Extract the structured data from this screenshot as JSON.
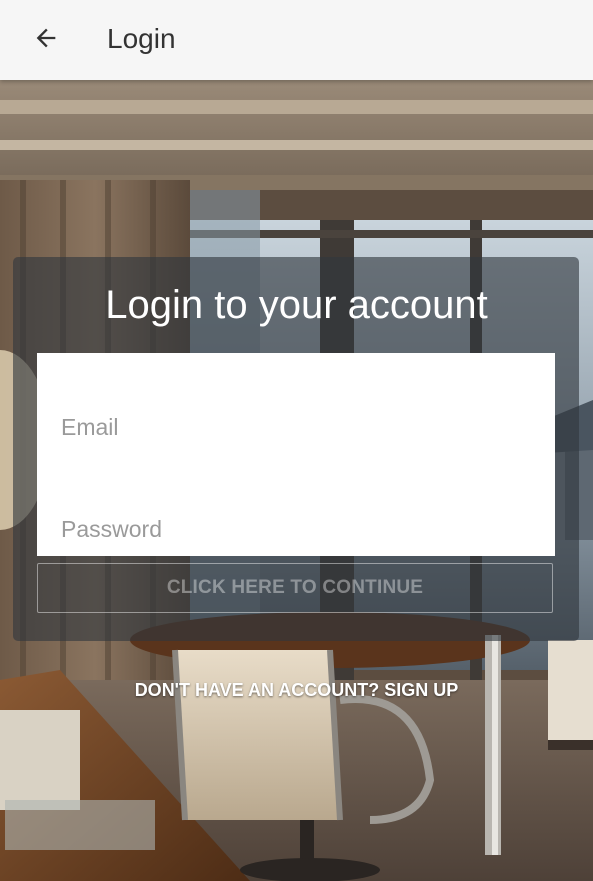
{
  "appbar": {
    "title": "Login",
    "back_icon": "arrow-back-icon"
  },
  "card": {
    "title": "Login to your account"
  },
  "form": {
    "email_placeholder": "Email",
    "password_placeholder": "Password",
    "continue_label": "CLICK HERE TO CONTINUE"
  },
  "footer": {
    "signup_label": "DON'T HAVE AN ACCOUNT? SIGN UP"
  },
  "colors": {
    "appbar_bg": "#f6f6f6",
    "card_overlay": "#30373e",
    "title_text": "#ffffff"
  }
}
